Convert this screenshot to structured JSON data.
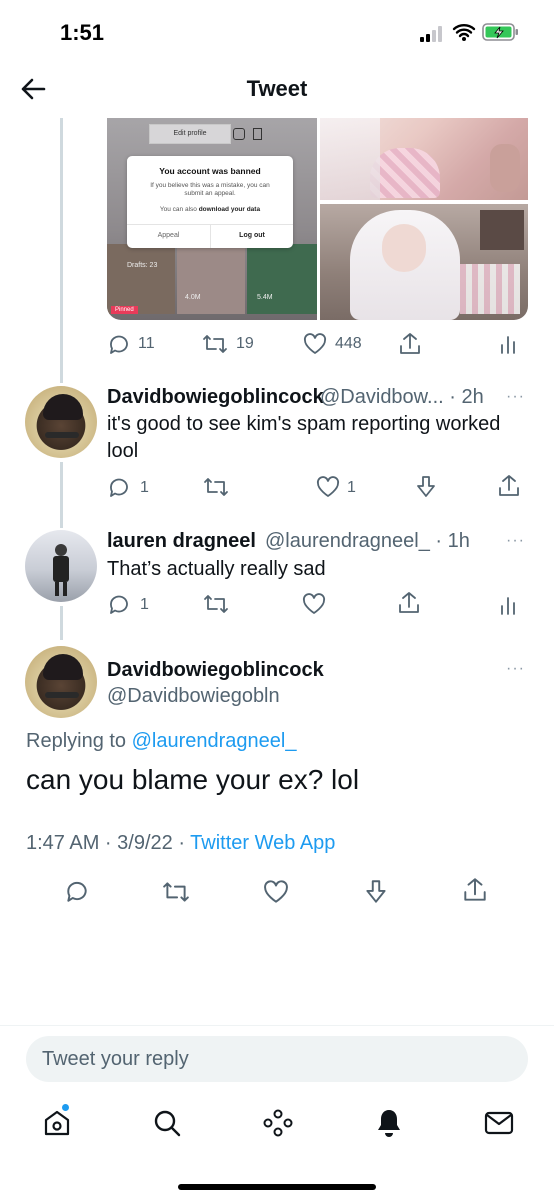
{
  "status_bar": {
    "time": "1:51"
  },
  "nav": {
    "title": "Tweet"
  },
  "embedded_screenshot": {
    "edit_profile": "Edit profile",
    "dialog_title": "You account was banned",
    "dialog_body": "If you believe this was a mistake, you can submit an appeal.",
    "dialog_data_prefix": "You can also ",
    "dialog_data_link": "download your data",
    "appeal": "Appeal",
    "logout": "Log out",
    "drafts": "Drafts: 23",
    "views_a": "4.0M",
    "views_b": "5.4M",
    "pinned": "Pinned"
  },
  "first_tweet_actions": {
    "replies": "11",
    "retweets": "19",
    "likes": "448"
  },
  "reply1": {
    "name": "Davidbowiegoblincock",
    "handle_time": "@Davidbow... · 2h",
    "text": "it's good to see kim's spam reporting worked lool",
    "replies": "1",
    "likes": "1"
  },
  "reply2": {
    "name": "lauren dragneel",
    "handle_time": "@laurendragneel_ · 1h",
    "text": "That’s actually really sad",
    "replies": "1"
  },
  "main": {
    "name": "Davidbowiegoblincock",
    "handle": "@Davidbowiegobln",
    "replying_label": "Replying to ",
    "replying_handle": "@laurendragneel_",
    "text": "can you blame your ex? lol",
    "timestamp": "1:47 AM · 3/9/22 · ",
    "source": "Twitter Web App"
  },
  "composer": {
    "placeholder": "Tweet your reply"
  },
  "more_glyph": "···",
  "colors": {
    "link": "#1d9bf0",
    "muted": "#536471",
    "border": "#eff3f4",
    "battery": "#34c759",
    "notification_dot": "#1d9bf0"
  }
}
